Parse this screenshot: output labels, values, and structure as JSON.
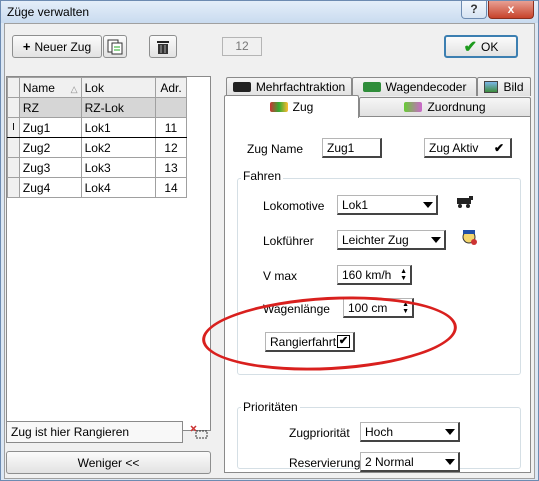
{
  "window": {
    "title": "Züge verwalten",
    "help": "?",
    "close": "x"
  },
  "toolbar": {
    "new_train": "Neuer Zug",
    "copy_icon": "copy-icon",
    "delete_icon": "trash-icon",
    "count": "12",
    "ok": "OK"
  },
  "grid": {
    "headers": [
      "Name",
      "Lok",
      "Adr."
    ],
    "rows": [
      {
        "name": "RZ",
        "lok": "RZ-Lok",
        "adr": "",
        "indicator": ""
      },
      {
        "name": "Zug1",
        "lok": "Lok1",
        "adr": "11",
        "indicator": "I"
      },
      {
        "name": "Zug2",
        "lok": "Lok2",
        "adr": "12",
        "indicator": ""
      },
      {
        "name": "Zug3",
        "lok": "Lok3",
        "adr": "13",
        "indicator": ""
      },
      {
        "name": "Zug4",
        "lok": "Lok4",
        "adr": "14",
        "indicator": ""
      }
    ]
  },
  "left_bottom": {
    "rangier_status": "Zug ist hier Rangieren",
    "less_button": "Weniger <<"
  },
  "tabs": {
    "row1": [
      "Mehrfachtraktion",
      "Wagendecoder",
      "Bild"
    ],
    "row2": [
      "Zug",
      "Zuordnung"
    ]
  },
  "zug_tab": {
    "name_label": "Zug Name",
    "name_value": "Zug1",
    "active_label": "Zug Aktiv",
    "active_mark": "✔",
    "fahren_title": "Fahren",
    "loco_label": "Lokomotive",
    "loco_value": "Lok1",
    "driver_label": "Lokführer",
    "driver_value": "Leichter Zug",
    "vmax_label": "V max",
    "vmax_value": "160 km/h",
    "length_label": "Wagenlänge",
    "length_value": "100 cm",
    "shunting_label": "Rangierfahrt",
    "shunting_mark": "✔",
    "prio_title": "Prioritäten",
    "train_prio_label": "Zugpriorität",
    "train_prio_value": "Hoch",
    "reservation_label": "Reservierung",
    "reservation_value": "2 Normal"
  }
}
